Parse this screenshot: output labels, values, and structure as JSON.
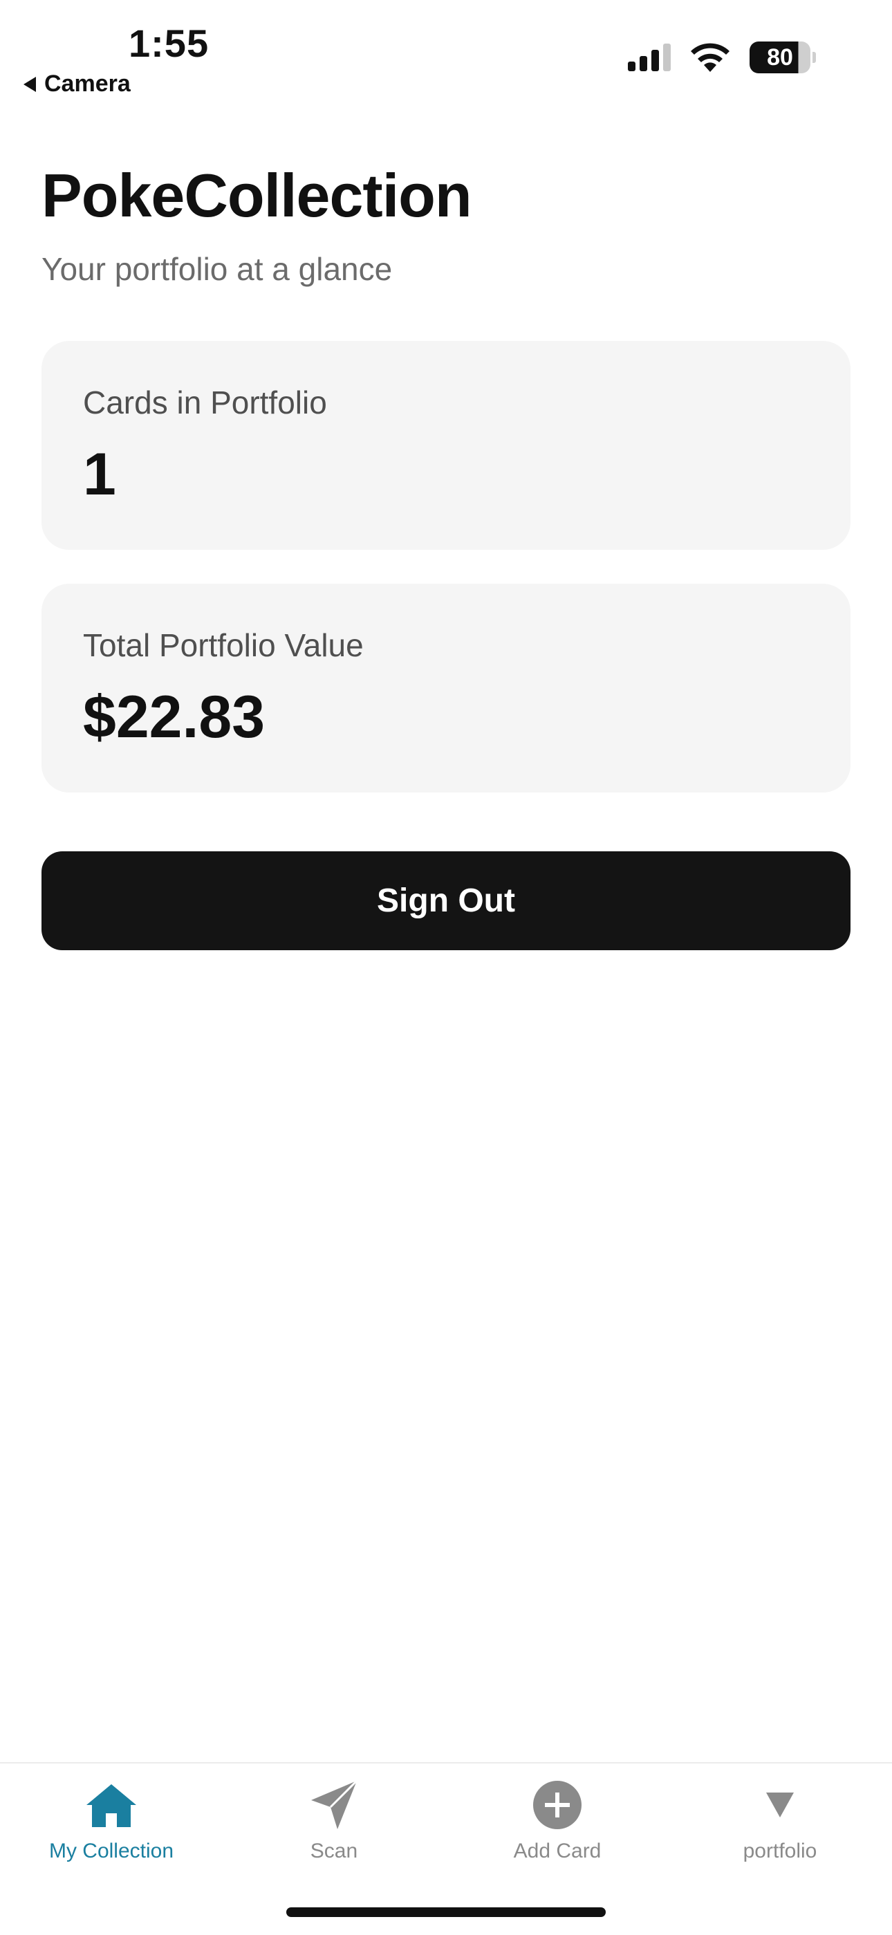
{
  "status_bar": {
    "time": "1:55",
    "back_label": "Camera",
    "battery_level": "80"
  },
  "header": {
    "title": "PokeCollection",
    "subtitle": "Your portfolio at a glance"
  },
  "stats": [
    {
      "label": "Cards in Portfolio",
      "value": "1"
    },
    {
      "label": "Total Portfolio Value",
      "value": "$22.83"
    }
  ],
  "actions": {
    "sign_out_label": "Sign Out"
  },
  "tabbar": {
    "items": [
      {
        "label": "My Collection",
        "icon": "house-icon",
        "active": true
      },
      {
        "label": "Scan",
        "icon": "paperplane-icon",
        "active": false
      },
      {
        "label": "Add Card",
        "icon": "plus-circle-icon",
        "active": false
      },
      {
        "label": "portfolio",
        "icon": "triangle-down-icon",
        "active": false
      }
    ]
  },
  "colors": {
    "accent": "#1a7fa0",
    "inactive_tab": "#8a8a8a",
    "button_bg": "#141414",
    "card_bg": "#f5f5f5"
  }
}
